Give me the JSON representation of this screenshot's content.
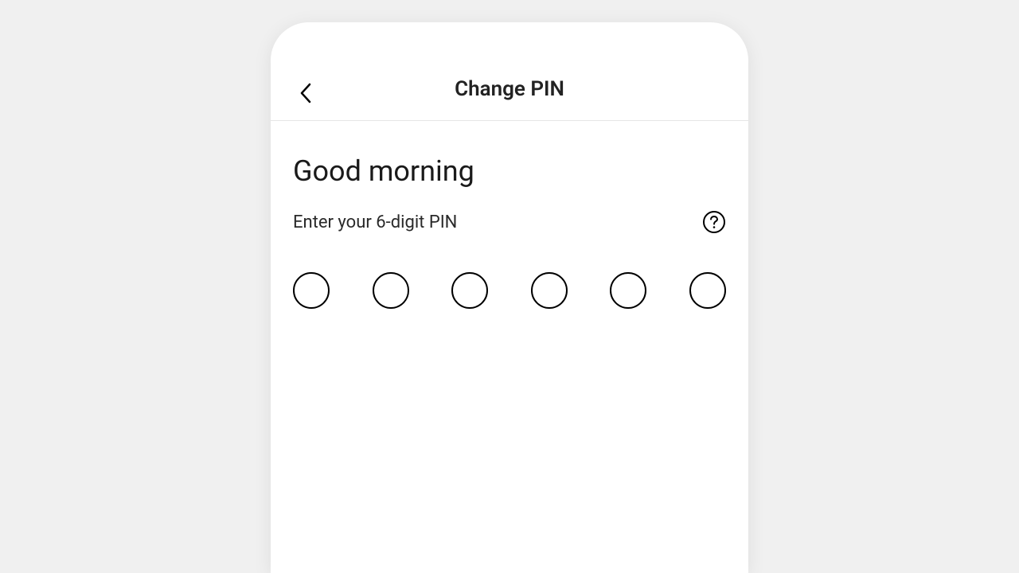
{
  "header": {
    "title": "Change PIN"
  },
  "greeting": "Good morning",
  "instruction": "Enter your 6-digit PIN",
  "pin": {
    "length": 6
  }
}
